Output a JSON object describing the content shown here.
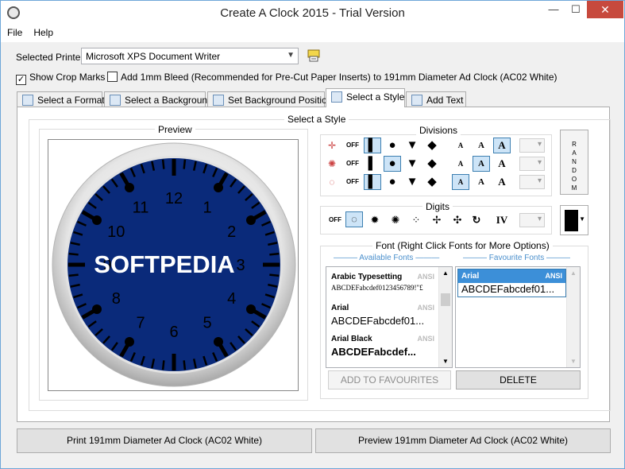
{
  "window": {
    "title": "Create A Clock 2015 - Trial Version",
    "min": "—",
    "max": "☐",
    "close": "✕"
  },
  "menu": {
    "file": "File",
    "help": "Help"
  },
  "printer": {
    "label": "Selected Printer",
    "value": "Microsoft XPS Document Writer"
  },
  "options": {
    "crop_marks": "Show Crop Marks",
    "crop_checked": true,
    "bleed": "Add 1mm Bleed (Recommended for Pre-Cut Paper Inserts) to 191mm Diameter Ad Clock (AC02 White)",
    "bleed_checked": false
  },
  "tabs": [
    "Select a Format",
    "Select a Background",
    "Set Background Position",
    "Select a Style",
    "Add Text"
  ],
  "active_tab": 3,
  "panel": {
    "title": "Select a Style",
    "preview_title": "Preview"
  },
  "clock": {
    "numbers": [
      "12",
      "1",
      "2",
      "3",
      "4",
      "5",
      "6",
      "7",
      "8",
      "9",
      "10",
      "11"
    ],
    "logo": "SOFTPEDIA",
    "face_color": "#0a2a7a",
    "rim_color": "#d8d8d8"
  },
  "divisions": {
    "title": "Divisions",
    "off": "OFF",
    "letter": "A"
  },
  "digits": {
    "title": "Digits",
    "off": "OFF",
    "roman": "IV"
  },
  "random": [
    "R",
    "A",
    "N",
    "D",
    "O",
    "M"
  ],
  "font": {
    "title": "Font (Right Click Fonts for More Options)",
    "available_label": "Available Fonts",
    "favourite_label": "Favourite Fonts",
    "available": [
      {
        "name": "Arabic Typesetting",
        "tag": "ANSI",
        "sample": "ABCDEFabcdef0123456789!\"£"
      },
      {
        "name": "Arial",
        "tag": "ANSI",
        "sample": "ABCDEFabcdef01..."
      },
      {
        "name": "Arial Black",
        "tag": "ANSI",
        "sample": "ABCDEFabcdef..."
      }
    ],
    "favourites": [
      {
        "name": "Arial",
        "tag": "ANSI",
        "sample": "ABCDEFabcdef01..."
      }
    ],
    "add_button": "ADD TO FAVOURITES",
    "delete_button": "DELETE"
  },
  "bottom": {
    "print": "Print 191mm Diameter Ad Clock (AC02 White)",
    "preview": "Preview 191mm Diameter Ad Clock (AC02 White)"
  }
}
